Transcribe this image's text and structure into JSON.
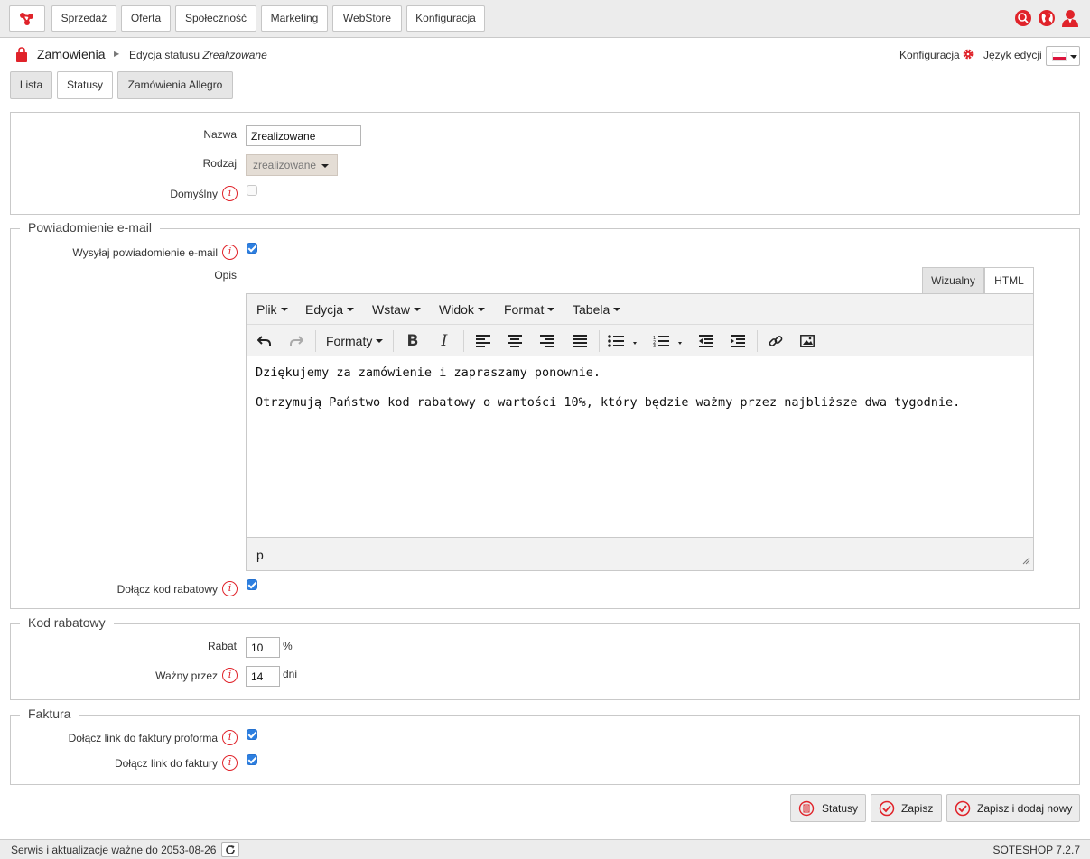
{
  "nav": {
    "logo_icon": "share-nodes-icon",
    "items": [
      {
        "label": "Sprzedaż"
      },
      {
        "label": "Oferta"
      },
      {
        "label": "Społeczność"
      },
      {
        "label": "Marketing"
      },
      {
        "label": "WebStore"
      },
      {
        "label": "Konfiguracja"
      }
    ],
    "right_icons": [
      "search-icon",
      "globe-icon",
      "user-icon"
    ],
    "accent_color": "#e0232a"
  },
  "breadcrumb": {
    "section": "Zamowienia",
    "sub_prefix": "Edycja statusu",
    "sub_item": "Zrealizowane"
  },
  "header_right": {
    "config_label": "Konfiguracja",
    "language_label": "Język edycji",
    "language_flag": "pl-flag-icon"
  },
  "tabs": [
    {
      "label": "Lista",
      "active": false
    },
    {
      "label": "Statusy",
      "active": true
    },
    {
      "label": "Zamówienia Allegro",
      "active": false
    }
  ],
  "general": {
    "name_label": "Nazwa",
    "name_value": "Zrealizowane",
    "type_label": "Rodzaj",
    "type_value": "zrealizowane",
    "default_label": "Domyślny",
    "default_checked": false
  },
  "email": {
    "legend": "Powiadomienie e-mail",
    "send_label": "Wysyłaj powiadomienie e-mail",
    "send_checked": true,
    "desc_label": "Opis",
    "mode_visual": "Wizualny",
    "mode_html": "HTML",
    "menu": [
      "Plik",
      "Edycja",
      "Wstaw",
      "Widok",
      "Format",
      "Tabela"
    ],
    "formats_label": "Formaty",
    "content": [
      "Dziękujemy za zamówienie i zapraszamy ponownie.",
      "Otrzymują Państwo kod rabatowy o wartości 10%, który będzie ważmy przez najbliższe dwa tygodnie."
    ],
    "path": "p",
    "attach_code_label": "Dołącz kod rabatowy",
    "attach_code_checked": true
  },
  "discount": {
    "legend": "Kod rabatowy",
    "rabat_label": "Rabat",
    "rabat_value": "10",
    "rabat_unit": "%",
    "valid_label": "Ważny przez",
    "valid_value": "14",
    "valid_unit": "dni"
  },
  "invoice": {
    "legend": "Faktura",
    "proforma_label": "Dołącz link do faktury proforma",
    "proforma_checked": true,
    "invoice_label": "Dołącz link do faktury",
    "invoice_checked": true
  },
  "actions": {
    "statusy": "Statusy",
    "zapisz": "Zapisz",
    "zapisz_nowy": "Zapisz i dodaj nowy"
  },
  "footer": {
    "service_text": "Serwis i aktualizacje ważne do 2053-08-26",
    "version": "SOTESHOP 7.2.7"
  }
}
